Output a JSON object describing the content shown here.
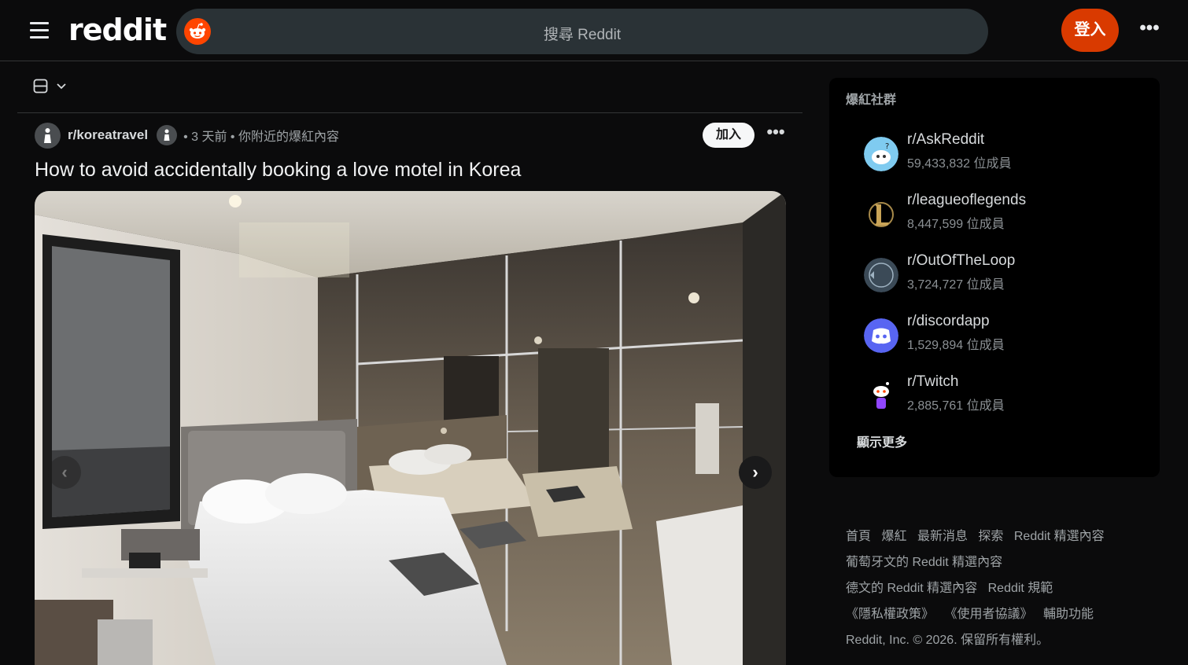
{
  "header": {
    "wordmark": "reddit",
    "search_placeholder": "搜尋 Reddit",
    "login_label": "登入",
    "more_label": "•••"
  },
  "post": {
    "subreddit": "r/koreatravel",
    "time_meta": "• 3 天前 • 你附近的爆紅內容",
    "join_label": "加入",
    "more_label": "•••",
    "title": "How to avoid accidentally booking a love motel in Korea",
    "carousel_prev": "‹",
    "carousel_next": "›"
  },
  "sidebar": {
    "heading": "爆紅社群",
    "communities": [
      {
        "name": "r/AskReddit",
        "members": "59,433,832 位成員",
        "icon": "askreddit-icon"
      },
      {
        "name": "r/leagueoflegends",
        "members": "8,447,599 位成員",
        "icon": "leagueoflegends-icon"
      },
      {
        "name": "r/OutOfTheLoop",
        "members": "3,724,727 位成員",
        "icon": "outoftheloop-icon"
      },
      {
        "name": "r/discordapp",
        "members": "1,529,894 位成員",
        "icon": "discord-icon"
      },
      {
        "name": "r/Twitch",
        "members": "2,885,761 位成員",
        "icon": "twitch-icon"
      }
    ],
    "show_more": "顯示更多"
  },
  "footer": {
    "line1": [
      "首頁",
      "爆紅",
      "最新消息",
      "探索",
      "Reddit 精選內容"
    ],
    "line2": [
      "葡萄牙文的 Reddit 精選內容"
    ],
    "line3": [
      "德文的 Reddit 精選內容",
      "Reddit 規範"
    ],
    "line4": [
      "《隱私權政策》",
      "《使用者協議》",
      "輔助功能"
    ],
    "copyright": "Reddit, Inc. © 2026. 保留所有權利。"
  },
  "colors": {
    "accent": "#d93a00",
    "background": "#0b0b0c",
    "search_bg": "#2a3236"
  }
}
